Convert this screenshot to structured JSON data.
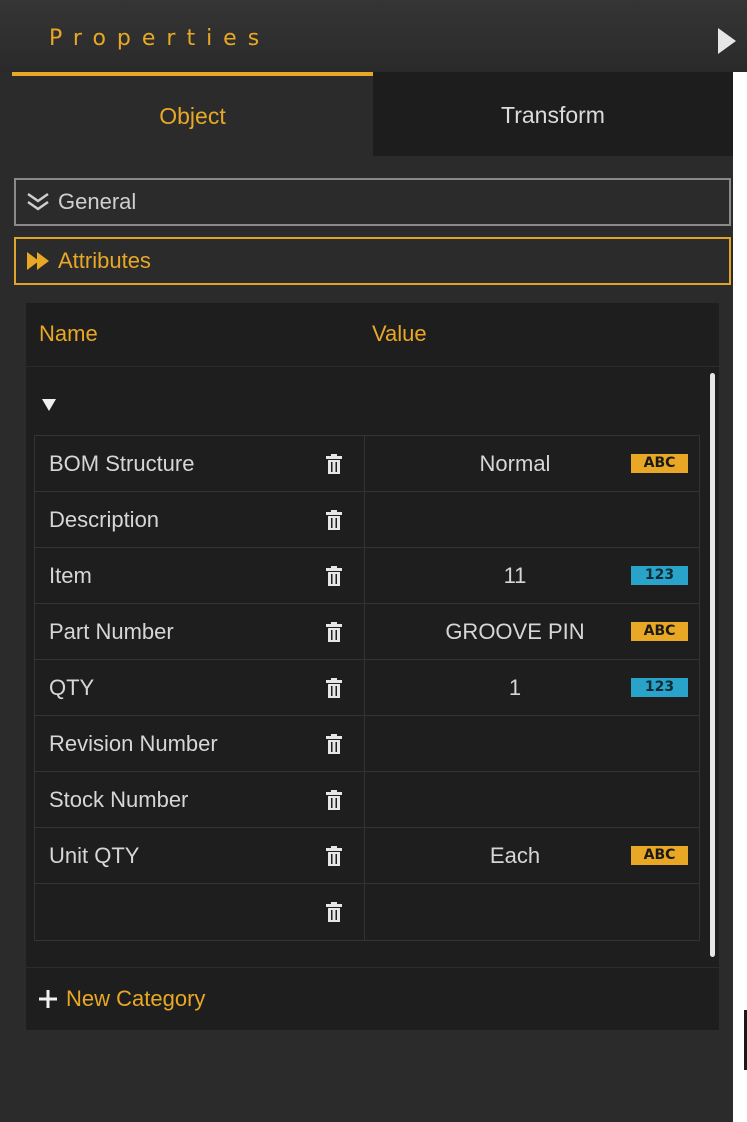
{
  "panel": {
    "title": "Properties",
    "collapse_icon": "triangle-right-icon"
  },
  "tabs": [
    {
      "label": "Object",
      "active": true
    },
    {
      "label": "Transform",
      "active": false
    }
  ],
  "sections": {
    "general": {
      "label": "General",
      "icon": "double-chevron-down-icon",
      "expanded": false
    },
    "attributes": {
      "label": "Attributes",
      "icon": "double-arrow-right-icon",
      "expanded": true
    }
  },
  "attributes": {
    "columns": {
      "name": "Name",
      "value": "Value"
    },
    "group_toggle_icon": "triangle-down-icon",
    "rows": [
      {
        "name": "BOM Structure",
        "value": "Normal",
        "type": "ABC"
      },
      {
        "name": "Description",
        "value": "",
        "type": ""
      },
      {
        "name": "Item",
        "value": "11",
        "type": "123"
      },
      {
        "name": "Part Number",
        "value": "GROOVE PIN",
        "type": "ABC"
      },
      {
        "name": "QTY",
        "value": "1",
        "type": "123"
      },
      {
        "name": "Revision Number",
        "value": "",
        "type": ""
      },
      {
        "name": "Stock Number",
        "value": "",
        "type": ""
      },
      {
        "name": "Unit QTY",
        "value": "Each",
        "type": "ABC"
      },
      {
        "name": "",
        "value": "",
        "type": ""
      }
    ],
    "new_category_label": "New Category"
  },
  "colors": {
    "accent": "#e8a825",
    "numeric_badge": "#29a3c9",
    "background": "#2b2b2b",
    "table_background": "#1e1e1e"
  }
}
